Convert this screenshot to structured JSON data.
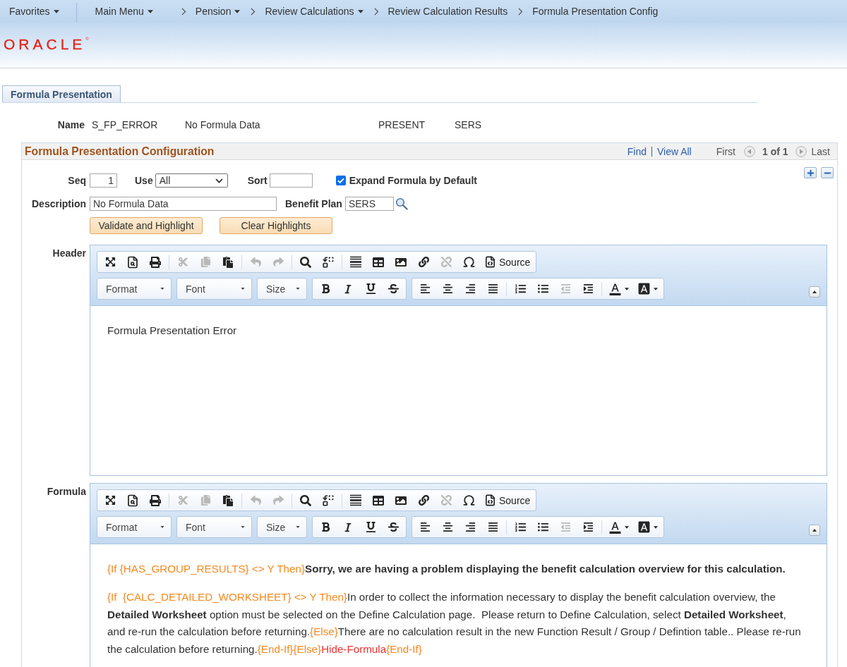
{
  "nav": {
    "favorites": {
      "label": "Favorites",
      "menu": true
    },
    "breadcrumbs": [
      {
        "label": "Main Menu",
        "menu": true
      },
      {
        "label": "Pension",
        "menu": true
      },
      {
        "label": "Review Calculations",
        "menu": true
      },
      {
        "label": "Review Calculation Results",
        "menu": false
      },
      {
        "label": "Formula Presentation Config",
        "menu": false
      }
    ]
  },
  "logo": {
    "text": "ORACLE$^{®}$"
  },
  "tabs": [
    {
      "label": "Formula Presentation",
      "selected": true
    }
  ],
  "name_row": {
    "label": "Name",
    "values": [
      "S_FP_ERROR",
      "No Formula Data",
      "PRESENT",
      "SERS"
    ]
  },
  "config": {
    "title": "Formula Presentation Configuration",
    "pager": {
      "find": "Find",
      "view_all": "View All",
      "first": "First",
      "position": "1 of 1",
      "last": "Last"
    },
    "seq": {
      "label": "Seq",
      "value": "1"
    },
    "use": {
      "label": "Use",
      "value": "All"
    },
    "sort": {
      "label": "Sort"
    },
    "expand": {
      "label": "Expand Formula by Default",
      "checked": true
    },
    "description": {
      "label": "Description",
      "value": "No Formula Data"
    },
    "benefit_plan": {
      "label": "Benefit Plan",
      "value": "SERS"
    },
    "buttons": [
      "Validate and Highlight",
      "Clear Highlights"
    ],
    "editors": [
      {
        "label": "Header",
        "toolbar": {
          "row_1": [
            [
              [
                {
                  "kind": "maximize",
                  "disabled": false
                },
                {
                  "kind": "preview",
                  "disabled": false
                },
                {
                  "kind": "print",
                  "disabled": false
                }
              ],
              [
                {
                  "kind": "cut",
                  "disabled": true
                },
                {
                  "kind": "copy",
                  "disabled": true
                },
                {
                  "kind": "paste",
                  "disabled": false
                }
              ],
              [
                {
                  "kind": "undo",
                  "disabled": true
                },
                {
                  "kind": "redo",
                  "disabled": true
                }
              ],
              [
                {
                  "kind": "find",
                  "disabled": false
                },
                {
                  "kind": "replace",
                  "disabled": false
                }
              ],
              [
                {
                  "kind": "rule",
                  "disabled": false
                },
                {
                  "kind": "table",
                  "disabled": false
                },
                {
                  "kind": "image",
                  "disabled": false
                },
                {
                  "kind": "link",
                  "disabled": false
                },
                {
                  "kind": "unlink",
                  "disabled": true
                },
                {
                  "kind": "symbol",
                  "disabled": false
                },
                {
                  "kind": "source",
                  "disabled": false,
                  "label": "Source"
                }
              ]
            ]
          ],
          "dropdowns": [
            "Format",
            "Font",
            "Size"
          ],
          "row_2": [
            [
              [
                {
                  "kind": "bold",
                  "disabled": false
                },
                {
                  "kind": "italic",
                  "disabled": false
                },
                {
                  "kind": "underline",
                  "disabled": false
                },
                {
                  "kind": "strike",
                  "disabled": false
                }
              ]
            ],
            [
              [
                {
                  "kind": "left",
                  "disabled": false
                },
                {
                  "kind": "center",
                  "disabled": false
                },
                {
                  "kind": "right",
                  "disabled": false
                },
                {
                  "kind": "justify",
                  "disabled": false
                }
              ],
              [
                {
                  "kind": "numbered",
                  "disabled": false
                },
                {
                  "kind": "bulleted",
                  "disabled": false
                },
                {
                  "kind": "outdent",
                  "disabled": true
                },
                {
                  "kind": "indent",
                  "disabled": false
                }
              ],
              [
                {
                  "kind": "textcolor",
                  "disabled": false
                },
                {
                  "kind": "bgcolor",
                  "disabled": false
                }
              ]
            ]
          ]
        },
        "paragraphs": [
          [
            {
              "kind": "text",
              "text": "Formula Presentation Error"
            }
          ]
        ]
      },
      {
        "label": "Formula",
        "toolbar": {
          "row_1": [
            [
              [
                {
                  "kind": "maximize",
                  "disabled": false
                },
                {
                  "kind": "preview",
                  "disabled": false
                },
                {
                  "kind": "print",
                  "disabled": false
                }
              ],
              [
                {
                  "kind": "cut",
                  "disabled": true
                },
                {
                  "kind": "copy",
                  "disabled": true
                },
                {
                  "kind": "paste",
                  "disabled": false
                }
              ],
              [
                {
                  "kind": "undo",
                  "disabled": true
                },
                {
                  "kind": "redo",
                  "disabled": true
                }
              ],
              [
                {
                  "kind": "find",
                  "disabled": false
                },
                {
                  "kind": "replace",
                  "disabled": false
                }
              ],
              [
                {
                  "kind": "rule",
                  "disabled": false
                },
                {
                  "kind": "table",
                  "disabled": false
                },
                {
                  "kind": "image",
                  "disabled": false
                },
                {
                  "kind": "link",
                  "disabled": false
                },
                {
                  "kind": "unlink",
                  "disabled": true
                },
                {
                  "kind": "symbol",
                  "disabled": false
                },
                {
                  "kind": "source",
                  "disabled": false,
                  "label": "Source"
                }
              ]
            ]
          ],
          "dropdowns": [
            "Format",
            "Font",
            "Size"
          ],
          "row_2": [
            [
              [
                {
                  "kind": "bold",
                  "disabled": false
                },
                {
                  "kind": "italic",
                  "disabled": false
                },
                {
                  "kind": "underline",
                  "disabled": false
                },
                {
                  "kind": "strike",
                  "disabled": false
                }
              ]
            ],
            [
              [
                {
                  "kind": "left",
                  "disabled": false
                },
                {
                  "kind": "center",
                  "disabled": false
                },
                {
                  "kind": "right",
                  "disabled": false
                },
                {
                  "kind": "justify",
                  "disabled": false
                }
              ],
              [
                {
                  "kind": "numbered",
                  "disabled": false
                },
                {
                  "kind": "bulleted",
                  "disabled": false
                },
                {
                  "kind": "outdent",
                  "disabled": true
                },
                {
                  "kind": "indent",
                  "disabled": false
                }
              ],
              [
                {
                  "kind": "textcolor",
                  "disabled": false
                },
                {
                  "kind": "bgcolor",
                  "disabled": false
                }
              ]
            ]
          ]
        },
        "paragraphs": [
          [
            {
              "kind": "code",
              "text": "{If {HAS_GROUP_RESULTS} <> Y Then}"
            },
            {
              "kind": "bold",
              "text": "Sorry, we are having a problem displaying the benefit calculation overview for this calculation."
            }
          ],
          [
            {
              "kind": "code",
              "text": "{If  {CALC_DETAILED_WORKSHEET} <> Y Then}"
            },
            {
              "kind": "text",
              "text": "In order to collect the information necessary to display the benefit calculation overview, the "
            },
            {
              "kind": "bold",
              "text": "Detailed Worksheet"
            },
            {
              "kind": "text",
              "text": " option must be selected on the Define Calculation page.  Please return to Define Calculation, select "
            },
            {
              "kind": "bold",
              "text": "Detailed Worksheet"
            },
            {
              "kind": "text",
              "text": ", and re-run the calculation before returning."
            },
            {
              "kind": "code",
              "text": "{Else}"
            },
            {
              "kind": "text",
              "text": "There are no calculation result in the new Function Result / Group / Defintion table.. Please re-run the calculation before returning."
            },
            {
              "kind": "code",
              "text": "{End-If}{Else}"
            },
            {
              "kind": "hidden",
              "text": "Hide-Formula"
            },
            {
              "kind": "code",
              "text": "{End-If}"
            }
          ]
        ]
      }
    ]
  }
}
